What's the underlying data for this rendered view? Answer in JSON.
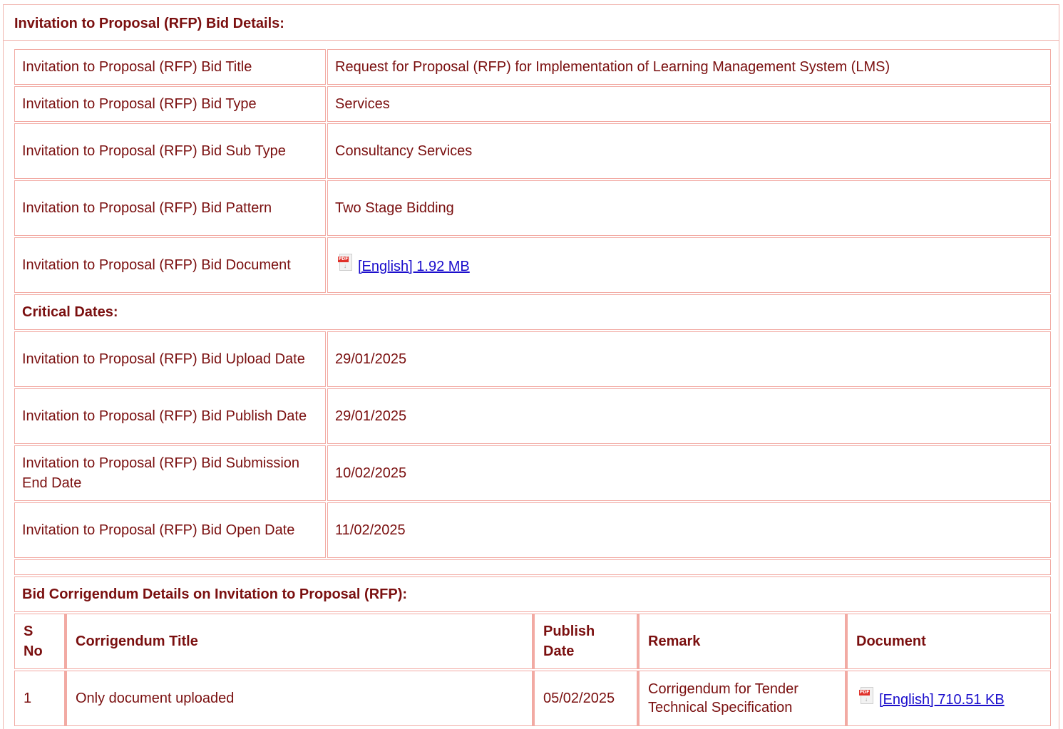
{
  "section_title": "Invitation to Proposal (RFP) Bid Details:",
  "bid_details": [
    {
      "label": "Invitation to Proposal (RFP) Bid Title",
      "value": "Request for Proposal (RFP) for Implementation of Learning Management System (LMS)"
    },
    {
      "label": "Invitation to Proposal (RFP) Bid Type",
      "value": "Services"
    },
    {
      "label": "Invitation to Proposal (RFP) Bid Sub Type",
      "value": "Consultancy Services"
    },
    {
      "label": "Invitation to Proposal (RFP) Bid Pattern",
      "value": "Two Stage Bidding"
    },
    {
      "label": "Invitation to Proposal (RFP) Bid Document",
      "value": "[English] 1.92 MB",
      "icon": "pdf-icon"
    }
  ],
  "critical_dates_title": "Critical Dates:",
  "critical_dates": [
    {
      "label": "Invitation to Proposal (RFP) Bid Upload Date",
      "value": "29/01/2025"
    },
    {
      "label": "Invitation to Proposal (RFP) Bid Publish Date",
      "value": "29/01/2025"
    },
    {
      "label": "Invitation to Proposal (RFP) Bid Submission End Date",
      "value": "10/02/2025"
    },
    {
      "label": "Invitation to Proposal (RFP) Bid Open Date",
      "value": "11/02/2025"
    }
  ],
  "corrigendum_title": "Bid Corrigendum Details on Invitation to Proposal (RFP):",
  "corrigendum_headers": [
    "S No",
    "Corrigendum Title",
    "Publish Date",
    "Remark",
    "Document"
  ],
  "corrigendum_rows": [
    {
      "sno": "1",
      "title": "Only document uploaded",
      "date": "05/02/2025",
      "remark": "Corrigendum for Tender Technical Specification",
      "document": "[English] 710.51 KB",
      "icon": "pdf-icon"
    }
  ],
  "colors": {
    "text": "#7a0f0f",
    "border": "#f2aaa3",
    "link": "#1a0dcc",
    "pdf_red": "#e0312a"
  }
}
